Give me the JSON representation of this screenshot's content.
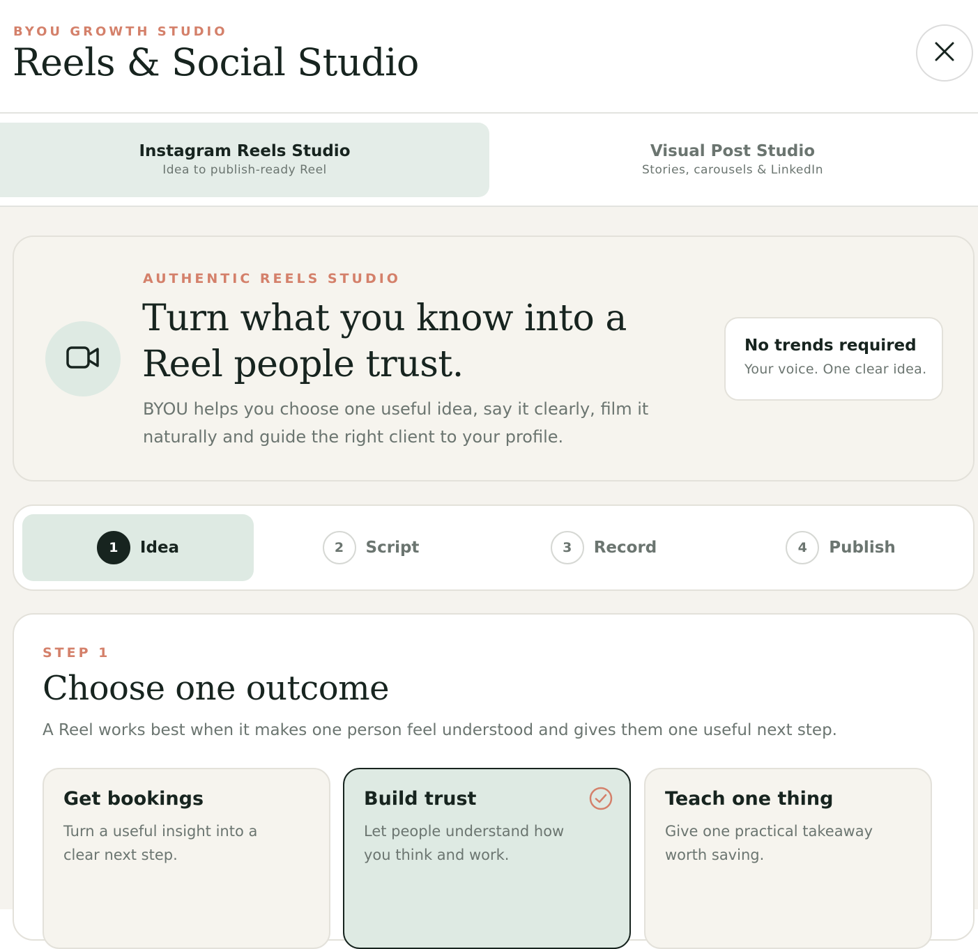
{
  "header": {
    "eyebrow": "BYOU GROWTH STUDIO",
    "title": "Reels & Social Studio",
    "close_icon": "close-icon"
  },
  "tabs": [
    {
      "title": "Instagram Reels Studio",
      "subtitle": "Idea to publish-ready Reel",
      "active": true
    },
    {
      "title": "Visual Post Studio",
      "subtitle": "Stories, carousels & LinkedIn",
      "active": false
    }
  ],
  "hero": {
    "icon": "video-camera-icon",
    "eyebrow": "AUTHENTIC REELS STUDIO",
    "title": "Turn what you know into a Reel people trust.",
    "description": "BYOU helps you choose one useful idea, say it clearly, film it naturally and guide the right client to your profile.",
    "badge": {
      "title": "No trends required",
      "subtitle": "Your voice. One clear idea."
    }
  },
  "stepper": [
    {
      "number": "1",
      "label": "Idea",
      "active": true
    },
    {
      "number": "2",
      "label": "Script",
      "active": false
    },
    {
      "number": "3",
      "label": "Record",
      "active": false
    },
    {
      "number": "4",
      "label": "Publish",
      "active": false
    }
  ],
  "step": {
    "eyebrow": "STEP 1",
    "title": "Choose one outcome",
    "description": "A Reel works best when it makes one person feel understood and gives them one useful next step.",
    "options": [
      {
        "title": "Get bookings",
        "description": "Turn a useful insight into a clear next step.",
        "selected": false
      },
      {
        "title": "Build trust",
        "description": "Let people understand how you think and work.",
        "selected": true
      },
      {
        "title": "Teach one thing",
        "description": "Give one practical takeaway worth saving.",
        "selected": false
      }
    ]
  },
  "colors": {
    "accent": "#d4806a",
    "active_bg": "#deeae3",
    "ink": "#17241f",
    "muted": "#6b7570",
    "page_bg": "#f5f3ee"
  }
}
